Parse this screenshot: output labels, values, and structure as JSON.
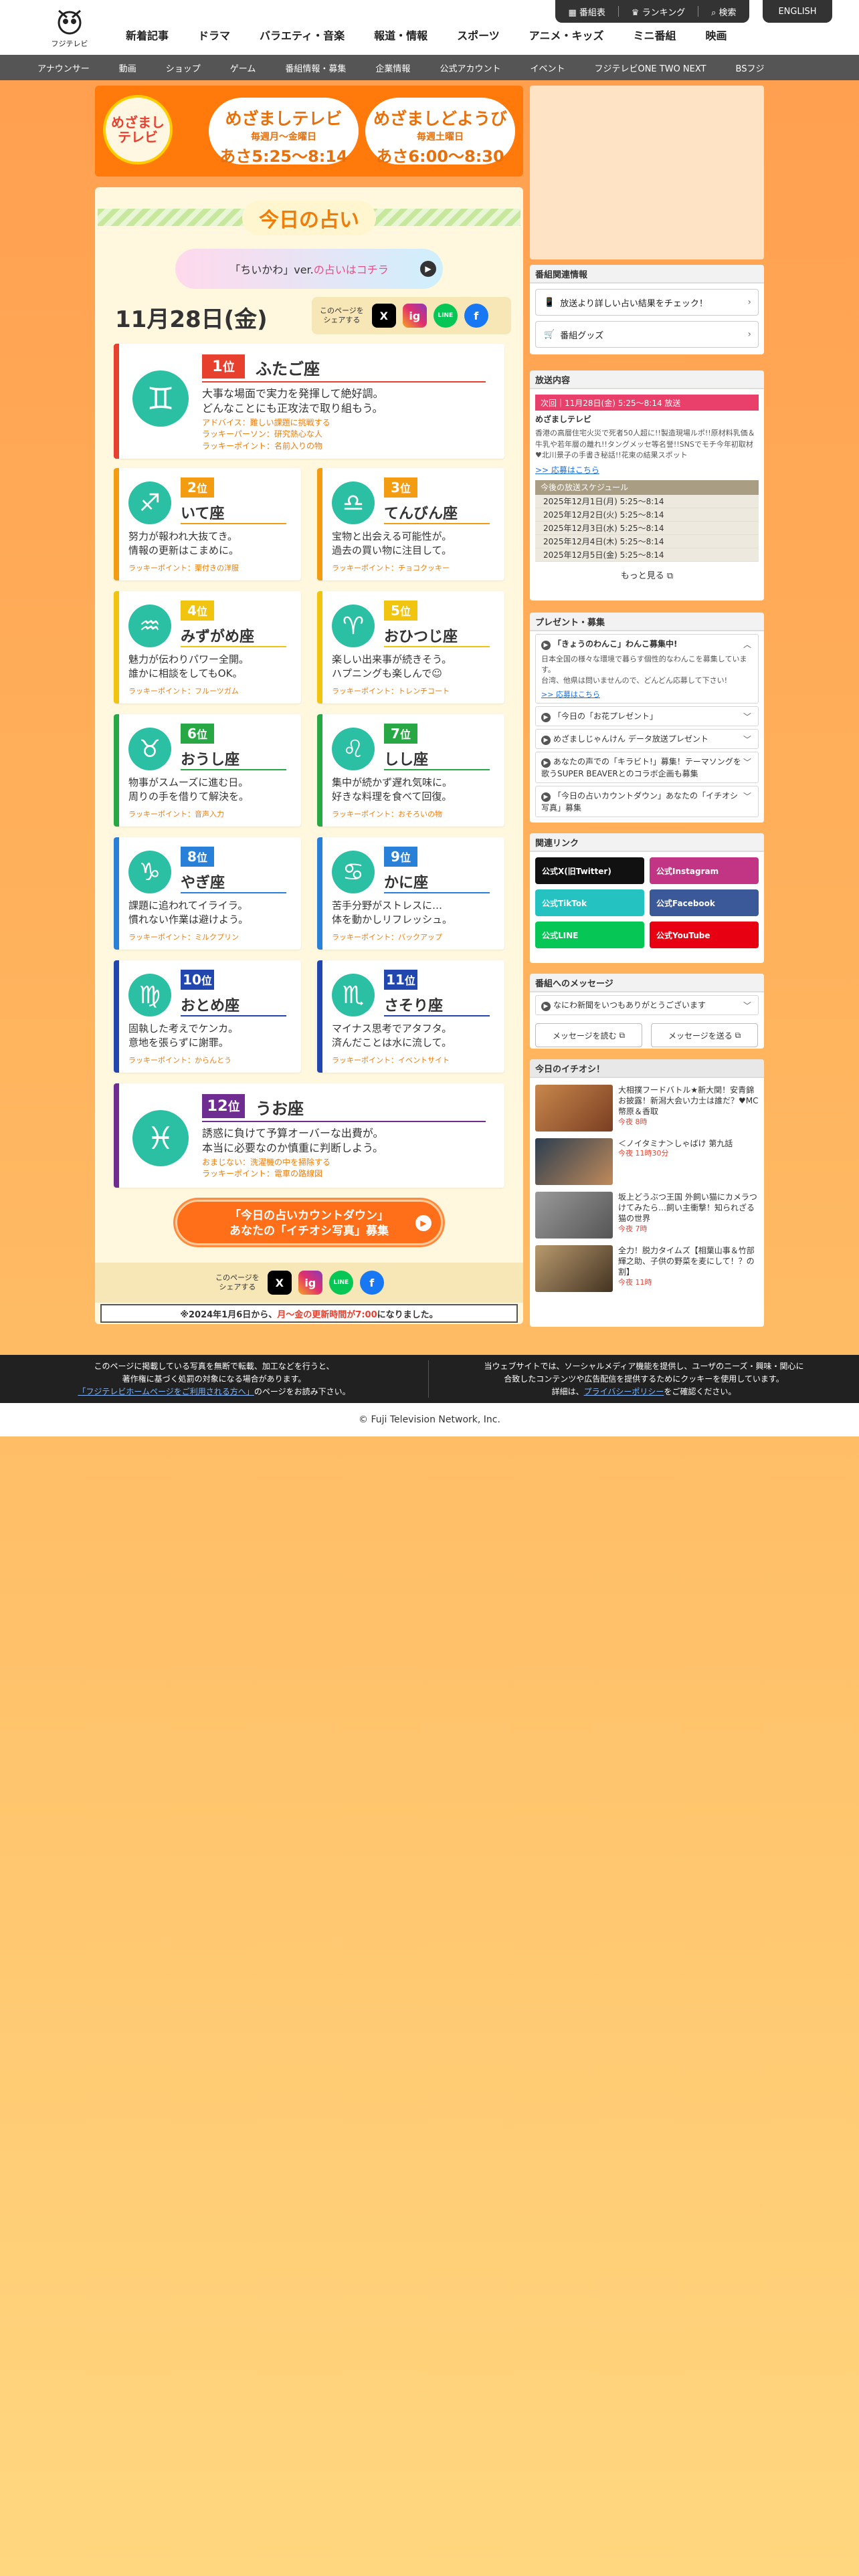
{
  "header": {
    "logo_text": "フジテレビ",
    "main_nav": [
      "新着記事",
      "ドラマ",
      "バラエティ・音楽",
      "報道・情報",
      "スポーツ",
      "アニメ・キッズ",
      "ミニ番組",
      "映画"
    ],
    "pills": [
      "番組表",
      "ランキング",
      "検索"
    ],
    "english": "ENGLISH",
    "sub_nav": [
      "アナウンサー",
      "動画",
      "ショップ",
      "ゲーム",
      "番組情報・募集",
      "企業情報",
      "公式アカウント",
      "イベント",
      "フジテレビONE TWO NEXT",
      "BSフジ"
    ]
  },
  "banner": {
    "logo_text": "めざまし\nテレビ",
    "box1": {
      "title": "めざましテレビ",
      "days": "毎週月〜金曜日",
      "time": "あさ5:25〜8:14"
    },
    "box2": {
      "title": "めざましどようび",
      "days": "毎週土曜日",
      "time": "あさ6:00〜8:30"
    }
  },
  "fortune": {
    "title": "今日の占い",
    "chiikawa_prefix": "「ちいかわ」ver.",
    "chiikawa_link": "の占いはコチラ",
    "date": "11月28日(金)",
    "share_label": "このページを\nシェアする",
    "icons": {
      "x": "X",
      "instagram": "ig",
      "line": "LINE",
      "facebook": "f"
    },
    "cards": [
      {
        "rank": "1",
        "unit": "位",
        "sign": "ふたご座",
        "symbol": "♊",
        "color": "#e8402f",
        "desc": "大事な場面で実力を発揮して絶好調。\nどんなことにも正攻法で取り組もう。",
        "lucky": "アドバイス：難しい課題に挑戦する\nラッキーパーソン：研究熱心な人\nラッキーポイント：名前入りの物"
      },
      {
        "rank": "2",
        "unit": "位",
        "sign": "いて座",
        "symbol": "♐",
        "color": "#f39c12",
        "desc": "努力が報われ大抜てき。\n情報の更新はこまめに。",
        "lucky": "ラッキーポイント：栗付きの洋服"
      },
      {
        "rank": "3",
        "unit": "位",
        "sign": "てんびん座",
        "symbol": "♎",
        "color": "#f39c12",
        "desc": "宝物と出会える可能性が。\n過去の買い物に注目して。",
        "lucky": "ラッキーポイント：チョコクッキー"
      },
      {
        "rank": "4",
        "unit": "位",
        "sign": "みずがめ座",
        "symbol": "♒",
        "color": "#f1c40f",
        "desc": "魅力が伝わりパワー全開。\n誰かに相談をしてもOK。",
        "lucky": "ラッキーポイント：フルーツガム"
      },
      {
        "rank": "5",
        "unit": "位",
        "sign": "おひつじ座",
        "symbol": "♈",
        "color": "#f1c40f",
        "desc": "楽しい出来事が続きそう。\nハプニングも楽しんで☺",
        "lucky": "ラッキーポイント：トレンチコート"
      },
      {
        "rank": "6",
        "unit": "位",
        "sign": "おうし座",
        "symbol": "♉",
        "color": "#27a844",
        "desc": "物事がスムーズに進む日。\n周りの手を借りて解決を。",
        "lucky": "ラッキーポイント：音声入力"
      },
      {
        "rank": "7",
        "unit": "位",
        "sign": "しし座",
        "symbol": "♌",
        "color": "#27a844",
        "desc": "集中が続かず遅れ気味に。\n好きな料理を食べて回復。",
        "lucky": "ラッキーポイント：おそろいの物"
      },
      {
        "rank": "8",
        "unit": "位",
        "sign": "やぎ座",
        "symbol": "♑",
        "color": "#2980d9",
        "desc": "課題に追われてイライラ。\n慣れない作業は避けよう。",
        "lucky": "ラッキーポイント：ミルクプリン"
      },
      {
        "rank": "9",
        "unit": "位",
        "sign": "かに座",
        "symbol": "♋",
        "color": "#2980d9",
        "desc": "苦手分野がストレスに…\n体を動かしリフレッシュ。",
        "lucky": "ラッキーポイント：バックアップ"
      },
      {
        "rank": "10",
        "unit": "位",
        "sign": "おとめ座",
        "symbol": "♍",
        "color": "#2146b0",
        "desc": "固執した考えでケンカ。\n意地を張らずに謝罪。",
        "lucky": "ラッキーポイント：からんとう"
      },
      {
        "rank": "11",
        "unit": "位",
        "sign": "さそり座",
        "symbol": "♏",
        "color": "#2146b0",
        "desc": "マイナス思考でアタフタ。\n済んだことは水に流して。",
        "lucky": "ラッキーポイント：イベントサイト"
      },
      {
        "rank": "12",
        "unit": "位",
        "sign": "うお座",
        "symbol": "♓",
        "color": "#6f2c91",
        "desc": "誘惑に負けて予算オーバーな出費が。\n本当に必要なのか慎重に判断しよう。",
        "lucky": "おまじない：洗濯機の中を掃除する\nラッキーポイント：電車の路線図"
      }
    ],
    "countdown_line1": "「今日の占いカウントダウン」",
    "countdown_line2": "あなたの「イチオシ写真」募集",
    "notice_prefix": "※2024年1月6日から、",
    "notice_emph": "月〜金の更新時間が7:00",
    "notice_suffix": "になりました。"
  },
  "sidebar": {
    "program_info": {
      "heading": "番組関連情報",
      "btn1": "放送より詳しい占い結果をチェック！",
      "btn2": "番組グッズ"
    },
    "broadcast": {
      "heading": "放送内容",
      "next": "次回｜11月28日(金) 5:25〜8:14 放送",
      "show": "めざましテレビ",
      "summary": "香港の高層住宅火災で死者50人超に!!製造現場ルポ!!原材料乳価＆牛乳や若年層の離れ!!タングメッセ等名誉!!SNSでモチ今年初取材♥北川景子の手書き秘話!!花束の結果スポット",
      "apply": ">> 応募はこちら",
      "schedule_heading": "今後の放送スケジュール",
      "schedule": [
        "2025年12月1日(月) 5:25〜8:14",
        "2025年12月2日(火) 5:25〜8:14",
        "2025年12月3日(水) 5:25〜8:14",
        "2025年12月4日(木) 5:25〜8:14",
        "2025年12月5日(金) 5:25〜8:14"
      ],
      "more": "もっと見る"
    },
    "present": {
      "heading": "プレゼント・募集",
      "first_title": "「きょうのわんこ」わんこ募集中!",
      "first_body": "日本全国の様々な環境で暮らす個性的なわんこを募集しています。\n台湾、他県は問いませんので、どんどん応募して下さい!",
      "first_link": ">> 応募はこちら",
      "items": [
        "「今日の「お花プレゼント」",
        "めざましじゃんけん データ放送プレゼント",
        "あなたの声での「キラビト!」募集！テーマソングを歌うSUPER BEAVERとのコラボ企画も募集",
        "「今日の占いカウントダウン」あなたの「イチオシ写真」募集"
      ]
    },
    "related": {
      "heading": "関連リンク",
      "links": [
        {
          "label": "公式X(旧Twitter)",
          "color": "#111111"
        },
        {
          "label": "公式Instagram",
          "color": "#c13584"
        },
        {
          "label": "公式TikTok",
          "color": "#25c2c2"
        },
        {
          "label": "公式Facebook",
          "color": "#3b5998"
        },
        {
          "label": "公式LINE",
          "color": "#06c755"
        },
        {
          "label": "公式YouTube",
          "color": "#e60012"
        }
      ]
    },
    "message": {
      "heading": "番組へのメッセージ",
      "notice": "なにわ新聞をいつもありがとうございます",
      "read": "メッセージを読む",
      "send": "メッセージを送る"
    },
    "picks": {
      "heading": "今日のイチオシ！",
      "items": [
        {
          "title": "大相撲フードバトル★新大関！安青錦お披露！新潟大会い力士は誰だ？♥MC幣原＆香取",
          "time": "今夜 8時"
        },
        {
          "title": "＜ノイタミナ＞しゃばけ 第九話",
          "time": "今夜 11時30分"
        },
        {
          "title": "坂上どうぶつ王国 外飼い猫にカメラつけてみたら…飼い主衝撃！知られざる猫の世界",
          "time": "今夜 7時"
        },
        {
          "title": "全力！脱力タイムズ【相葉山事＆竹部輝之助、子供の野菜を麦にして！？の割】",
          "time": "今夜 11時"
        }
      ]
    }
  },
  "footer": {
    "left_line1": "このページに掲載している写真を無断で転載、加工などを行うと、",
    "left_line2": "著作権に基づく処罰の対象になる場合があります。",
    "left_link": "「フジテレビホームページをご利用される方へ」",
    "left_line3_suffix": "のページをお読み下さい。",
    "right_line1": "当ウェブサイトでは、ソーシャルメディア機能を提供し、ユーザのニーズ・興味・関心に",
    "right_line2": "合致したコンテンツや広告配信を提供するためにクッキーを使用しています。",
    "right_line3_prefix": "詳細は、",
    "right_link": "プライバシーポリシー",
    "right_line3_suffix": "をご確認ください。",
    "copyright": "© Fuji Television Network, Inc."
  }
}
